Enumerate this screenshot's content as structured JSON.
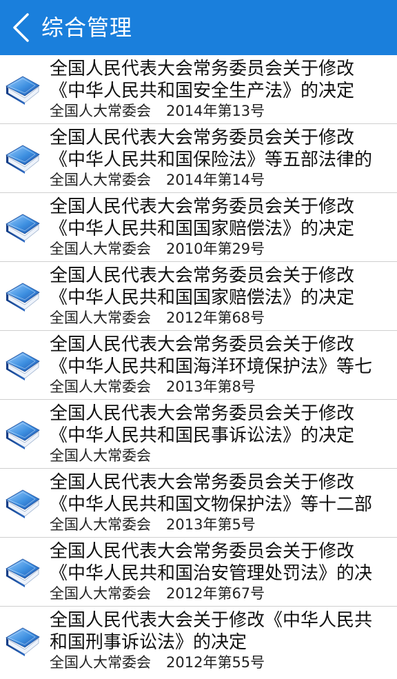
{
  "header": {
    "title": "综合管理",
    "bg_color": "#1a7fdc",
    "back_icon": "chevron-left-icon"
  },
  "list_icon": "book-icon",
  "items": [
    {
      "line1": "全国人民代表大会常务委员会关于修改",
      "line2": "《中华人民共和国安全生产法》的决定",
      "source": "全国人大常委会",
      "issue": "2014年第13号"
    },
    {
      "line1": "全国人民代表大会常务委员会关于修改",
      "line2": "《中华人民共和国保险法》等五部法律的",
      "source": "全国人大常委会",
      "issue": "2014年第14号"
    },
    {
      "line1": "全国人民代表大会常务委员会关于修改",
      "line2": "《中华人民共和国国家赔偿法》的决定",
      "source": "全国人大常委会",
      "issue": "2010年第29号"
    },
    {
      "line1": "全国人民代表大会常务委员会关于修改",
      "line2": "《中华人民共和国国家赔偿法》的决定",
      "source": "全国人大常委会",
      "issue": "2012年第68号"
    },
    {
      "line1": "全国人民代表大会常务委员会关于修改",
      "line2": "《中华人民共和国海洋环境保护法》等七",
      "source": "全国人大常委会",
      "issue": "2013年第8号"
    },
    {
      "line1": "全国人民代表大会常务委员会关于修改",
      "line2": "《中华人民共和国民事诉讼法》的决定",
      "source": "全国人大常委会",
      "issue": ""
    },
    {
      "line1": "全国人民代表大会常务委员会关于修改",
      "line2": "《中华人民共和国文物保护法》等十二部",
      "source": "全国人大常委会",
      "issue": "2013年第5号"
    },
    {
      "line1": "全国人民代表大会常务委员会关于修改",
      "line2": "《中华人民共和国治安管理处罚法》的决",
      "source": "全国人大常委会",
      "issue": "2012年第67号"
    },
    {
      "line1": "全国人民代表大会关于修改《中华人民共",
      "line2": "和国刑事诉讼法》的决定",
      "source": "全国人大常委会",
      "issue": "2012年第55号"
    }
  ]
}
